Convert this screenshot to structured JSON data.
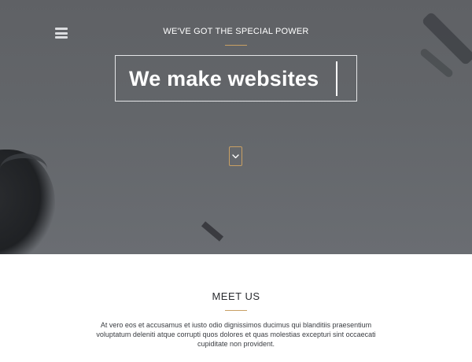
{
  "hero": {
    "tagline": "WE'VE GOT THE SPECIAL POWER",
    "headline": "We make websites",
    "menu_icon": "hamburger-menu-icon",
    "scroll_icon": "chevron-down-icon"
  },
  "meet_us": {
    "title": "MEET US",
    "body": "At vero eos et accusamus et iusto odio dignissimos ducimus qui blanditiis praesentium voluptatum deleniti atque corrupti quos dolores et quas molestias excepturi sint occaecati cupiditate non provident."
  },
  "colors": {
    "hero_bg": "#63666a",
    "accent": "#c9a064",
    "text_light": "#ffffff",
    "text_dark": "#2a2c30"
  }
}
